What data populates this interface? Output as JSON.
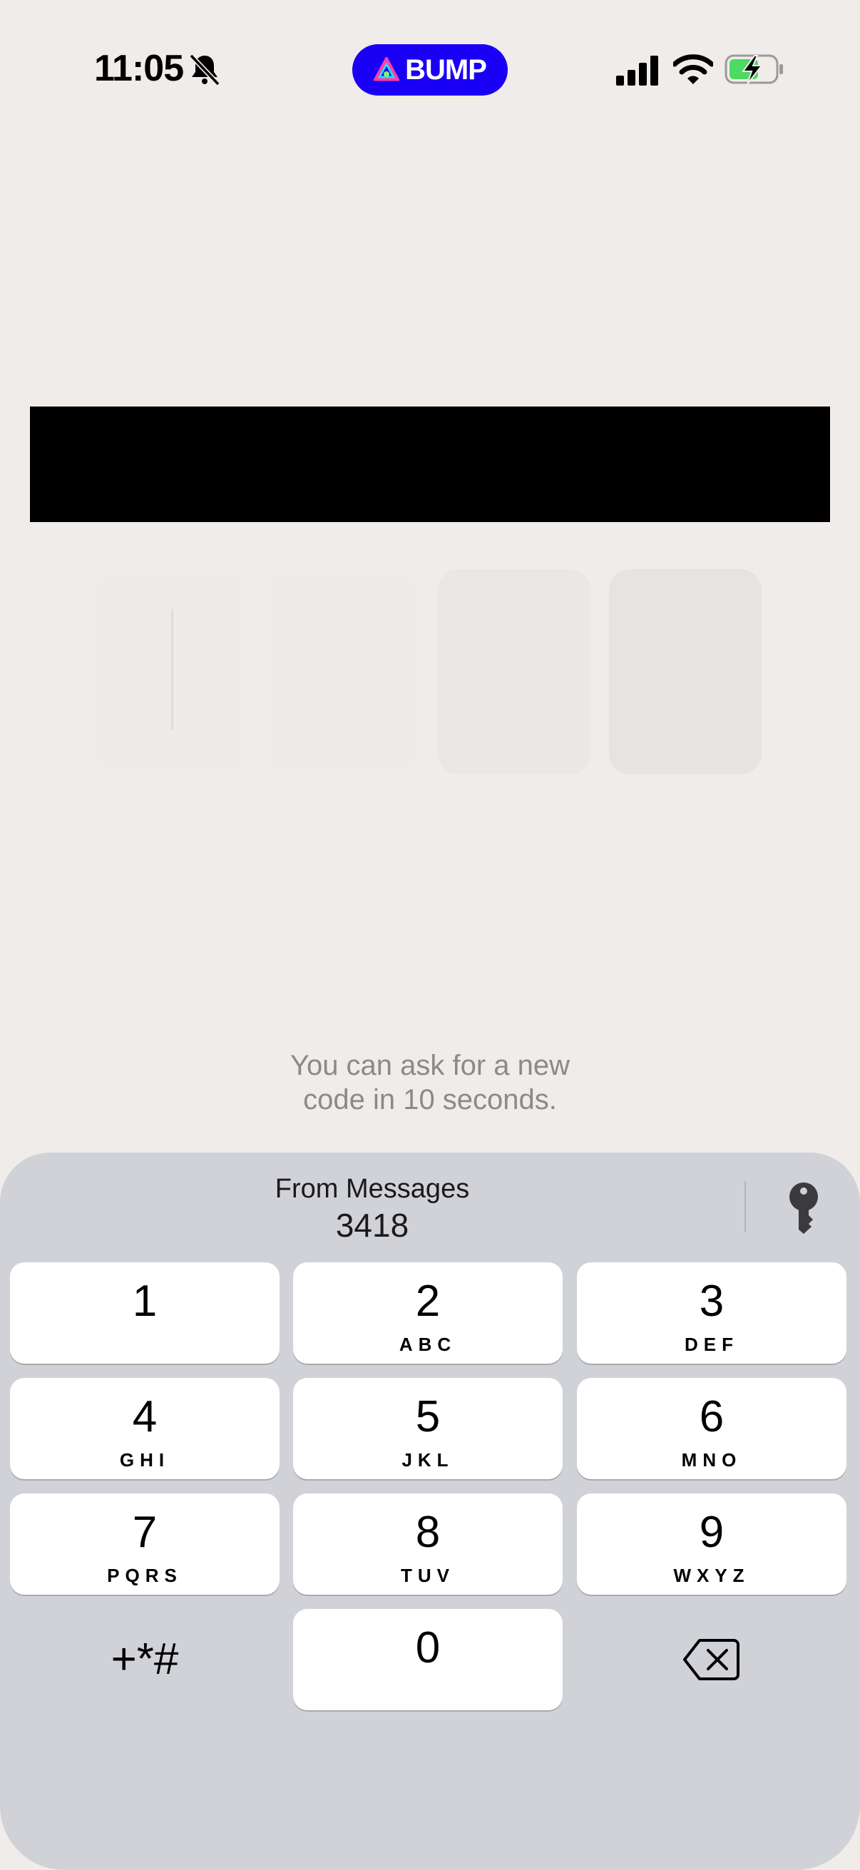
{
  "status_bar": {
    "time": "11:05",
    "app_badge": "BUMP",
    "icons": [
      "bell-slash-icon",
      "signal-icon",
      "wifi-icon",
      "battery-charging-icon"
    ]
  },
  "code_entry": {
    "digits": [
      "",
      "",
      "",
      ""
    ],
    "resend_line1": "You can ask for a new",
    "resend_line2": "code in 10 seconds."
  },
  "keyboard": {
    "suggestion_label": "From Messages",
    "suggestion_code": "3418",
    "keys": [
      {
        "num": "1",
        "letters": ""
      },
      {
        "num": "2",
        "letters": "ABC"
      },
      {
        "num": "3",
        "letters": "DEF"
      },
      {
        "num": "4",
        "letters": "GHI"
      },
      {
        "num": "5",
        "letters": "JKL"
      },
      {
        "num": "6",
        "letters": "MNO"
      },
      {
        "num": "7",
        "letters": "PQRS"
      },
      {
        "num": "8",
        "letters": "TUV"
      },
      {
        "num": "9",
        "letters": "WXYZ"
      },
      {
        "num": "0",
        "letters": ""
      }
    ],
    "symbols_label": "+*#"
  },
  "colors": {
    "background": "#f0ecea",
    "brand": "#1a00f5",
    "keyboard": "#d1d2d8"
  }
}
